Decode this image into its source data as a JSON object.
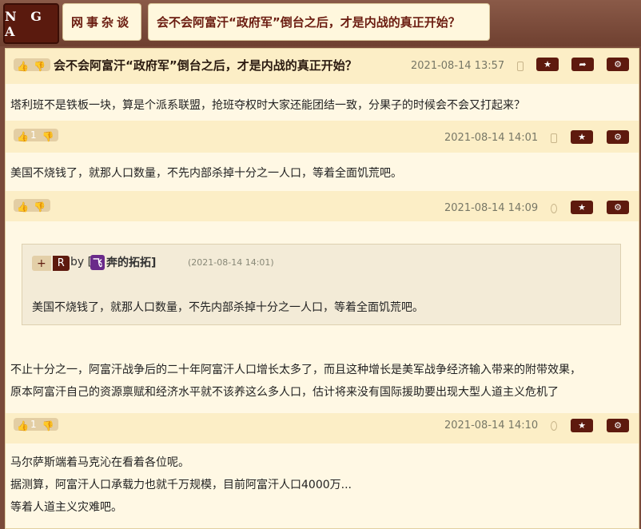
{
  "nav": {
    "logo": "N G A",
    "section": "网事杂谈",
    "thread": "会不会阿富汗“政府军”倒台之后，才是内战的真正开始？"
  },
  "posts": [
    {
      "title": "会不会阿富汗“政府军”倒台之后，才是内战的真正开始？",
      "time": "2021-08-14 13:57",
      "votes": "",
      "device": "android-icon",
      "lines": [
        "塔利班不是铁板一块，算是个派系联盟，抢班夺权时大家还能团结一致，分果子的时候会不会又打起来？"
      ]
    },
    {
      "time": "2021-08-14 14:01",
      "votes": "1",
      "device": "phone-icon",
      "lines": [
        "美国不烧钱了，就那人口数量，不先内部杀掉十分之一人口，等着全面饥荒吧。"
      ]
    },
    {
      "time": "2021-08-14 14:09",
      "votes": "",
      "device": "apple-icon",
      "quote": {
        "plus": "+",
        "reply": "R",
        "by": "by [",
        "author_badge": "飞",
        "author": "奔的拓拓]",
        "time": "(2021-08-14 14:01)",
        "text": "美国不烧钱了，就那人口数量，不先内部杀掉十分之一人口，等着全面饥荒吧。"
      },
      "lines": [
        "不止十分之一，阿富汗战争后的二十年阿富汗人口增长太多了，而且这种增长是美军战争经济输入带来的附带效果，",
        "原本阿富汗自己的资源禀赋和经济水平就不该养这么多人口，估计将来没有国际援助要出现大型人道主义危机了"
      ]
    },
    {
      "time": "2021-08-14 14:10",
      "votes": "1",
      "device": "apple-icon",
      "lines": [
        "马尔萨斯端着马克沁在看着各位呢。",
        "据测算，阿富汗人口承载力也就千万规模，目前阿富汗人口4000万...",
        "等着人道主义灾难吧。"
      ]
    }
  ],
  "buttons": {
    "star": "★",
    "share": "➦",
    "gear": "⚙"
  }
}
